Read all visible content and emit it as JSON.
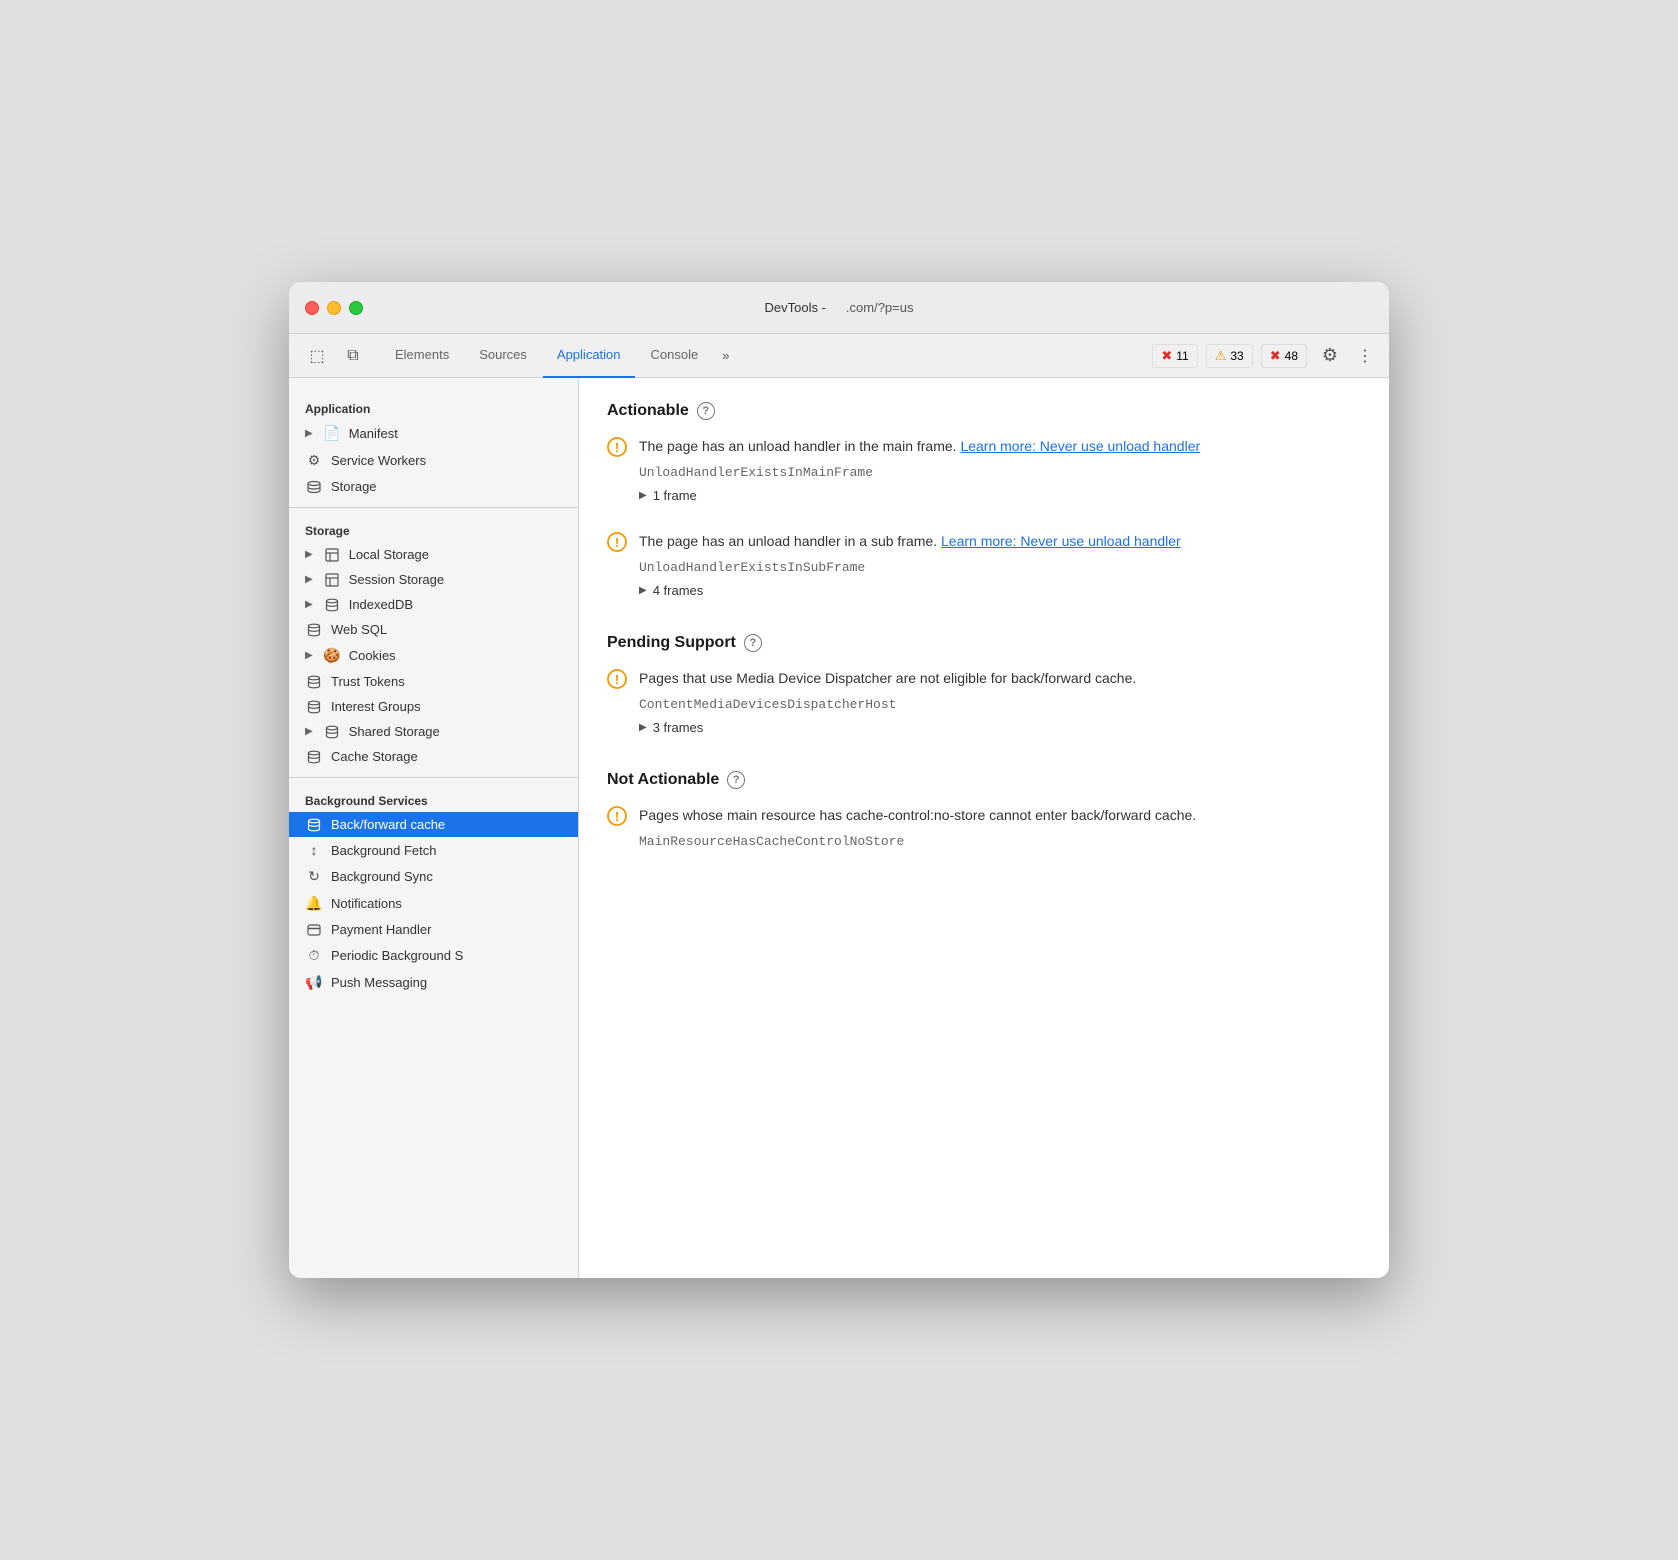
{
  "window": {
    "title": "DevTools -",
    "url": ".com/?p=us"
  },
  "toolbar": {
    "tabs": [
      {
        "id": "elements",
        "label": "Elements",
        "active": false
      },
      {
        "id": "sources",
        "label": "Sources",
        "active": false
      },
      {
        "id": "application",
        "label": "Application",
        "active": true
      },
      {
        "id": "console",
        "label": "Console",
        "active": false
      }
    ],
    "more_label": "»",
    "badges": [
      {
        "id": "error",
        "icon": "✖",
        "count": "11",
        "type": "error"
      },
      {
        "id": "warning",
        "icon": "⚠",
        "count": "33",
        "type": "warning"
      },
      {
        "id": "info",
        "icon": "✖",
        "count": "48",
        "type": "info"
      }
    ],
    "settings_icon": "⚙",
    "more_icon": "⋮"
  },
  "sidebar": {
    "sections": [
      {
        "id": "application",
        "label": "Application",
        "items": [
          {
            "id": "manifest",
            "icon": "▶",
            "secondary_icon": "📄",
            "label": "Manifest",
            "has_arrow": true
          },
          {
            "id": "service-workers",
            "icon": "⚙",
            "label": "Service Workers"
          },
          {
            "id": "storage",
            "icon": "🗄",
            "label": "Storage"
          }
        ]
      },
      {
        "id": "storage-section",
        "label": "Storage",
        "items": [
          {
            "id": "local-storage",
            "icon": "▶",
            "secondary_icon": "⊞",
            "label": "Local Storage",
            "has_arrow": true
          },
          {
            "id": "session-storage",
            "icon": "▶",
            "secondary_icon": "⊞",
            "label": "Session Storage",
            "has_arrow": true
          },
          {
            "id": "indexeddb",
            "icon": "▶",
            "secondary_icon": "🗄",
            "label": "IndexedDB",
            "has_arrow": true
          },
          {
            "id": "web-sql",
            "icon": "🗄",
            "label": "Web SQL"
          },
          {
            "id": "cookies",
            "icon": "▶",
            "secondary_icon": "🍪",
            "label": "Cookies",
            "has_arrow": true
          },
          {
            "id": "trust-tokens",
            "icon": "🗄",
            "label": "Trust Tokens"
          },
          {
            "id": "interest-groups",
            "icon": "🗄",
            "label": "Interest Groups"
          },
          {
            "id": "shared-storage",
            "icon": "▶",
            "secondary_icon": "🗄",
            "label": "Shared Storage",
            "has_arrow": true
          },
          {
            "id": "cache-storage",
            "icon": "🗄",
            "label": "Cache Storage"
          }
        ]
      },
      {
        "id": "background-services",
        "label": "Background Services",
        "items": [
          {
            "id": "back-forward-cache",
            "icon": "🗄",
            "label": "Back/forward cache",
            "active": true
          },
          {
            "id": "background-fetch",
            "icon": "↕",
            "label": "Background Fetch"
          },
          {
            "id": "background-sync",
            "icon": "↻",
            "label": "Background Sync"
          },
          {
            "id": "notifications",
            "icon": "🔔",
            "label": "Notifications"
          },
          {
            "id": "payment-handler",
            "icon": "🪪",
            "label": "Payment Handler"
          },
          {
            "id": "periodic-background",
            "icon": "⏱",
            "label": "Periodic Background S"
          },
          {
            "id": "push-messaging",
            "icon": "📢",
            "label": "Push Messaging"
          }
        ]
      }
    ]
  },
  "content": {
    "sections": [
      {
        "id": "actionable",
        "title": "Actionable",
        "issues": [
          {
            "id": "unload-main-frame",
            "text_before": "The page has an unload handler in the main frame.",
            "link_text": "Learn more: Never use unload handler",
            "code": "UnloadHandlerExistsInMainFrame",
            "frames_label": "1 frame"
          },
          {
            "id": "unload-sub-frame",
            "text_before": "The page has an unload handler in a sub frame.",
            "link_text": "Learn more: Never use unload handler",
            "code": "UnloadHandlerExistsInSubFrame",
            "frames_label": "4 frames"
          }
        ]
      },
      {
        "id": "pending-support",
        "title": "Pending Support",
        "issues": [
          {
            "id": "media-device-dispatcher",
            "text_before": "Pages that use Media Device Dispatcher are not eligible for back/forward cache.",
            "link_text": "",
            "code": "ContentMediaDevicesDispatcherHost",
            "frames_label": "3 frames"
          }
        ]
      },
      {
        "id": "not-actionable",
        "title": "Not Actionable",
        "issues": [
          {
            "id": "cache-control-no-store",
            "text_before": "Pages whose main resource has cache-control:no-store cannot enter back/forward cache.",
            "link_text": "",
            "code": "MainResourceHasCacheControlNoStore",
            "frames_label": ""
          }
        ]
      }
    ]
  }
}
